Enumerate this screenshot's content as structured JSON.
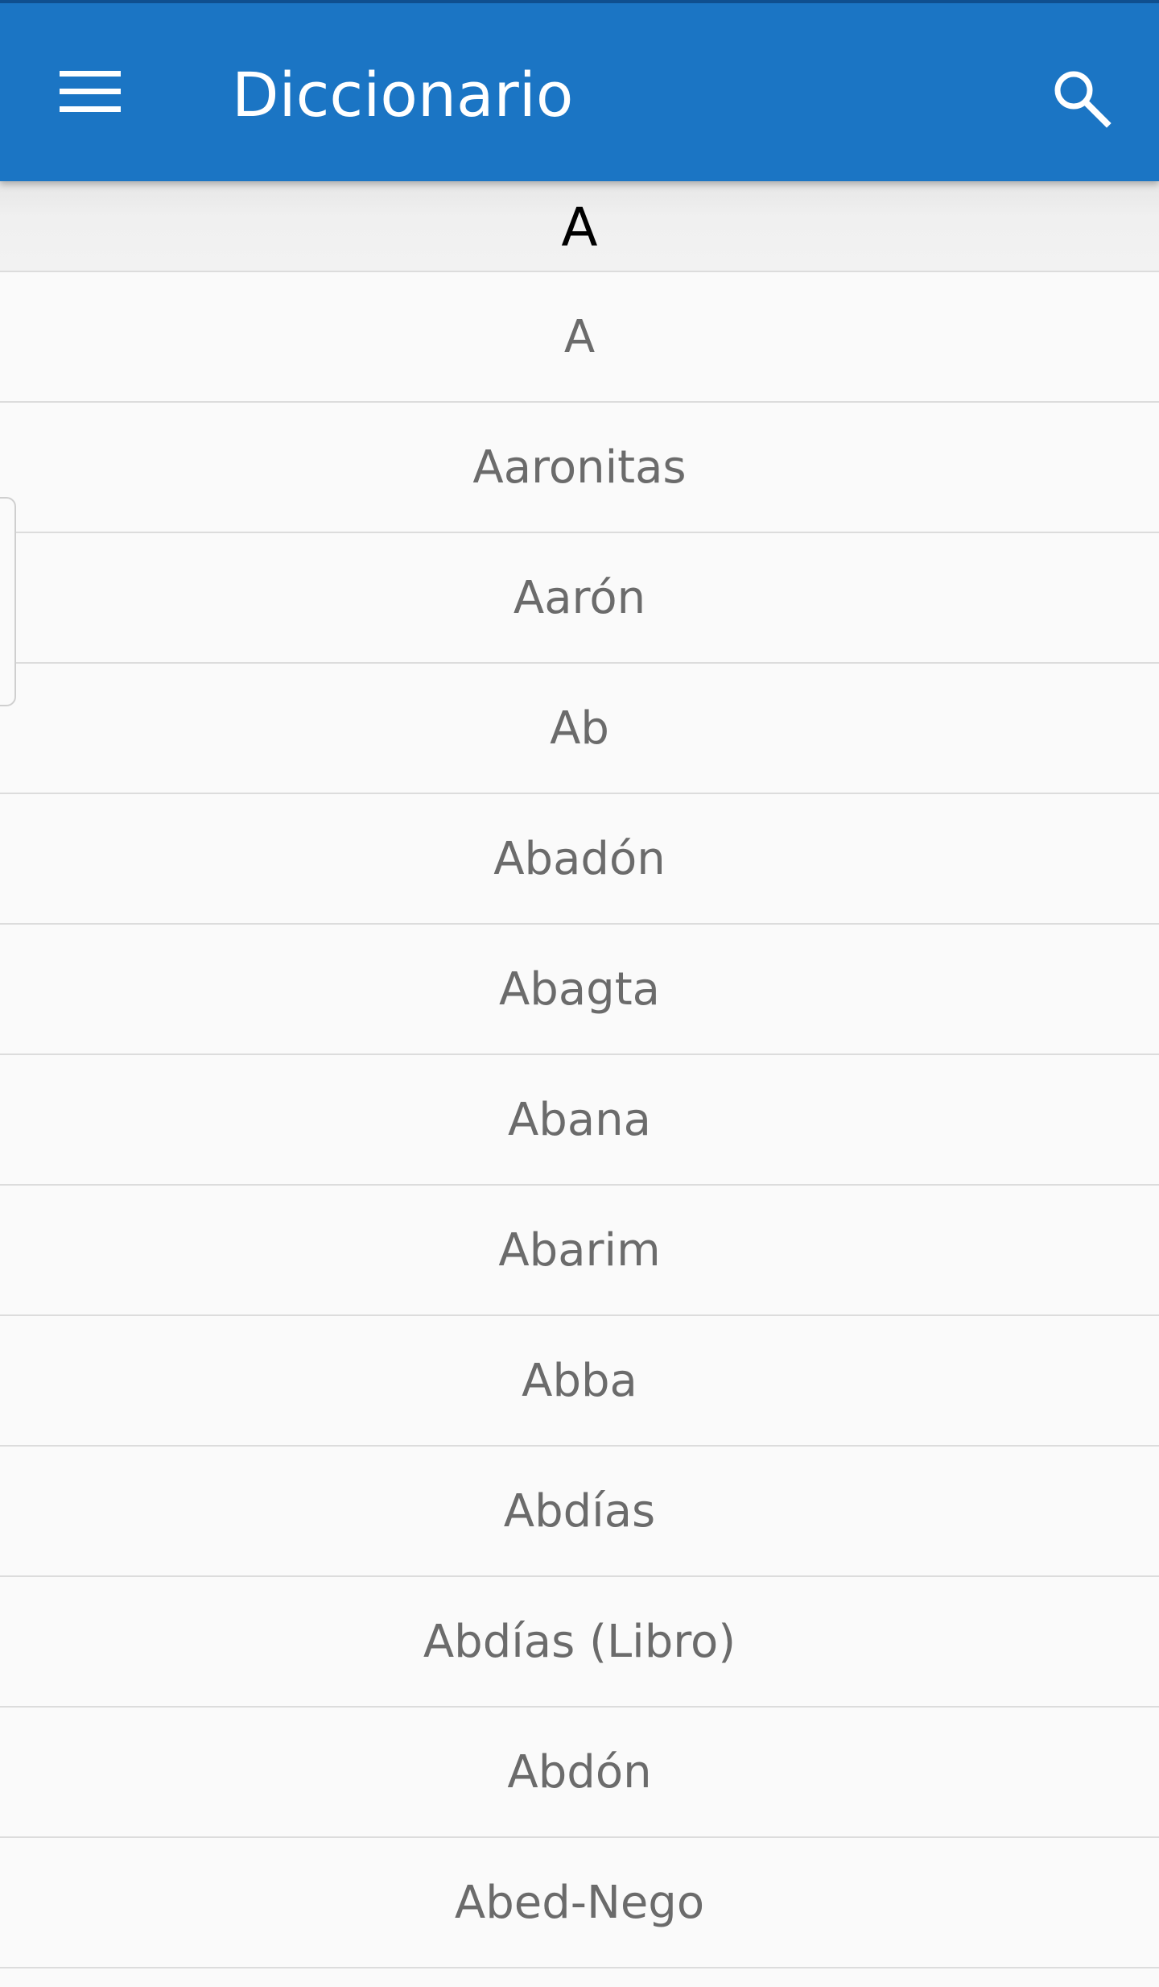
{
  "app_bar": {
    "title": "Diccionario",
    "menu_icon": "hamburger-menu-icon",
    "search_icon": "search-icon",
    "background_color": "#1b75c4"
  },
  "section_header": {
    "letter": "A"
  },
  "entries": [
    "A",
    "Aaronitas",
    "Aarón",
    "Ab",
    "Abadón",
    "Abagta",
    "Abana",
    "Abarim",
    "Abba",
    "Abdías",
    "Abdías (Libro)",
    "Abdón",
    "Abed-Nego"
  ]
}
